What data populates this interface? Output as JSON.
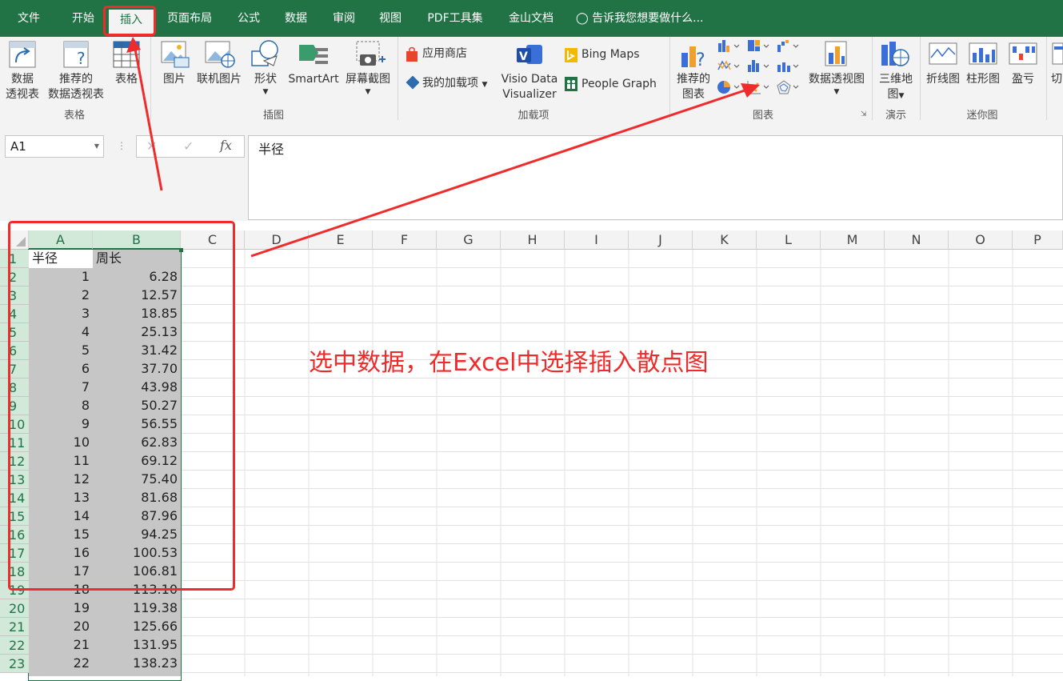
{
  "tabs": [
    "文件",
    "开始",
    "插入",
    "页面布局",
    "公式",
    "数据",
    "审阅",
    "视图",
    "PDF工具集",
    "金山文档"
  ],
  "tell_me": "告诉我您想要做什么...",
  "ribbon": {
    "tables": {
      "pivot_line1": "数据",
      "pivot_line2": "透视表",
      "rec_pivot_line1": "推荐的",
      "rec_pivot_line2": "数据透视表",
      "table": "表格",
      "group": "表格"
    },
    "illustrations": {
      "picture": "图片",
      "online_picture": "联机图片",
      "shapes": "形状",
      "smartart": "SmartArt",
      "screenshot": "屏幕截图",
      "group": "插图"
    },
    "addins": {
      "store": "应用商店",
      "my_addins": "我的加载项",
      "visio_line1": "Visio Data",
      "visio_line2": "Visualizer",
      "bing_maps": "Bing Maps",
      "people_graph": "People Graph",
      "group": "加载项"
    },
    "charts": {
      "rec_line1": "推荐的",
      "rec_line2": "图表",
      "pivot_chart": "数据透视图",
      "group": "图表"
    },
    "tours": {
      "map3d_line1": "三维地",
      "map3d_line2": "图",
      "group": "演示"
    },
    "sparklines": {
      "line": "折线图",
      "column": "柱形图",
      "winloss": "盈亏",
      "group": "迷你图"
    },
    "filters": {
      "slicer": "切"
    }
  },
  "formula_bar": {
    "name_box": "A1",
    "content": "半径"
  },
  "columns": [
    "A",
    "B",
    "C",
    "D",
    "E",
    "F",
    "G",
    "H",
    "I",
    "J",
    "K",
    "L",
    "M",
    "N",
    "O",
    "P"
  ],
  "rows": [
    {
      "n": "1",
      "a": "半径",
      "b": "周长"
    },
    {
      "n": "2",
      "a": "1",
      "b": "6.28"
    },
    {
      "n": "3",
      "a": "2",
      "b": "12.57"
    },
    {
      "n": "4",
      "a": "3",
      "b": "18.85"
    },
    {
      "n": "5",
      "a": "4",
      "b": "25.13"
    },
    {
      "n": "6",
      "a": "5",
      "b": "31.42"
    },
    {
      "n": "7",
      "a": "6",
      "b": "37.70"
    },
    {
      "n": "8",
      "a": "7",
      "b": "43.98"
    },
    {
      "n": "9",
      "a": "8",
      "b": "50.27"
    },
    {
      "n": "10",
      "a": "9",
      "b": "56.55"
    },
    {
      "n": "11",
      "a": "10",
      "b": "62.83"
    },
    {
      "n": "12",
      "a": "11",
      "b": "69.12"
    },
    {
      "n": "13",
      "a": "12",
      "b": "75.40"
    },
    {
      "n": "14",
      "a": "13",
      "b": "81.68"
    },
    {
      "n": "15",
      "a": "14",
      "b": "87.96"
    },
    {
      "n": "16",
      "a": "15",
      "b": "94.25"
    },
    {
      "n": "17",
      "a": "16",
      "b": "100.53"
    },
    {
      "n": "18",
      "a": "17",
      "b": "106.81"
    },
    {
      "n": "19",
      "a": "18",
      "b": "113.10"
    },
    {
      "n": "20",
      "a": "19",
      "b": "119.38"
    },
    {
      "n": "21",
      "a": "20",
      "b": "125.66"
    },
    {
      "n": "22",
      "a": "21",
      "b": "131.95"
    },
    {
      "n": "23",
      "a": "22",
      "b": "138.23"
    }
  ],
  "annotation": "选中数据，在Excel中选择插入散点图",
  "colors": {
    "excel_green": "#217346",
    "annotation_red": "#ef2b2b",
    "selection_fill": "#c6c6c6"
  }
}
